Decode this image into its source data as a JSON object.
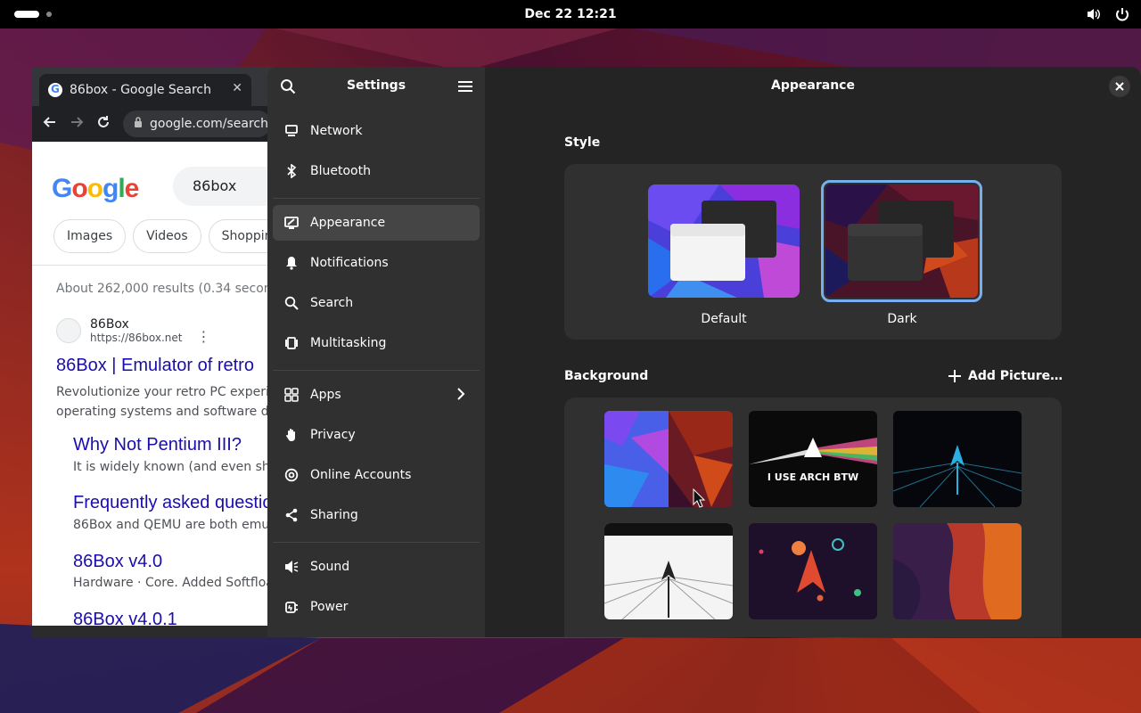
{
  "topbar": {
    "clock": "Dec 22  12:21"
  },
  "browser": {
    "tab_title": "86box - Google Search",
    "url": "google.com/search?",
    "search_query": "86box",
    "logo_text": "Google",
    "chips": [
      "Images",
      "Videos",
      "Shopping"
    ],
    "result_stats": "About 262,000 results (0.34 seconds)",
    "result": {
      "site_name": "86Box",
      "site_url": "https://86box.net",
      "title": "86Box | Emulator of retro",
      "snippet_1": "Revolutionize your retro PC experienc",
      "snippet_2": "operating systems and software desig"
    },
    "sublinks": [
      {
        "title": "Why Not Pentium III?",
        "snippet": "It is widely known (and even shown"
      },
      {
        "title": "Frequently asked questio",
        "snippet": "86Box and QEMU are both emulato"
      },
      {
        "title": "86Box v4.0",
        "snippet": "Hardware · Core. Added Softfloat F"
      },
      {
        "title": "86Box v4.0.1",
        "snippet": ""
      }
    ]
  },
  "settings": {
    "sidebar_title": "Settings",
    "items": [
      {
        "label": "Network",
        "icon": "network-icon"
      },
      {
        "label": "Bluetooth",
        "icon": "bluetooth-icon"
      },
      {
        "label": "Appearance",
        "icon": "appearance-icon",
        "active": true
      },
      {
        "label": "Notifications",
        "icon": "bell-icon"
      },
      {
        "label": "Search",
        "icon": "search-icon"
      },
      {
        "label": "Multitasking",
        "icon": "multitasking-icon"
      },
      {
        "label": "Apps",
        "icon": "apps-icon"
      },
      {
        "label": "Privacy",
        "icon": "hand-icon"
      },
      {
        "label": "Online Accounts",
        "icon": "at-icon"
      },
      {
        "label": "Sharing",
        "icon": "share-icon"
      },
      {
        "label": "Sound",
        "icon": "speaker-icon"
      },
      {
        "label": "Power",
        "icon": "power-plug-icon"
      }
    ],
    "page_title": "Appearance",
    "style_label": "Style",
    "style_options": [
      {
        "label": "Default",
        "selected": false
      },
      {
        "label": "Dark",
        "selected": true
      }
    ],
    "background_label": "Background",
    "add_picture": "Add Picture…",
    "wallpaper_text": "I USE ARCH BTW",
    "accent_color": "#78aeed"
  }
}
